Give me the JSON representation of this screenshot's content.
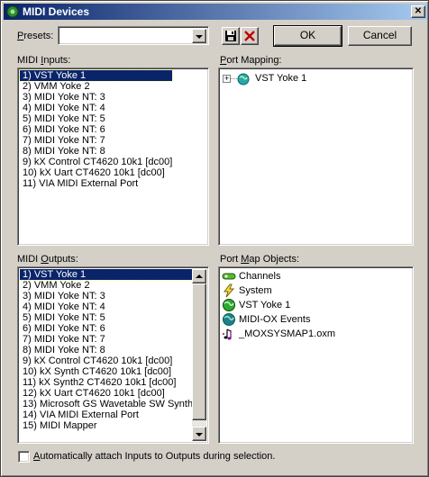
{
  "window": {
    "title": "MIDI Devices"
  },
  "presets": {
    "label_pre": "",
    "label_hot": "P",
    "label_post": "resets:",
    "value": ""
  },
  "buttons": {
    "ok": "OK",
    "cancel": "Cancel"
  },
  "midi_inputs": {
    "label_pre": "MIDI ",
    "label_hot": "I",
    "label_post": "nputs:",
    "items": [
      "1)  VST Yoke 1",
      "2)  VMM Yoke 2",
      "3)  MIDI Yoke NT:  3",
      "4)  MIDI Yoke NT:  4",
      "5)  MIDI Yoke NT:  5",
      "6)  MIDI Yoke NT:  6",
      "7)  MIDI Yoke NT:  7",
      "8)  MIDI Yoke NT:  8",
      "9)  kX Control CT4620 10k1 [dc00]",
      "10)  kX Uart CT4620 10k1 [dc00]",
      "11)  VIA MIDI External Port"
    ],
    "selected_index": 0
  },
  "port_mapping": {
    "label_pre": "",
    "label_hot": "P",
    "label_post": "ort Mapping:",
    "tree_expander": "+",
    "tree_item": "VST Yoke 1"
  },
  "midi_outputs": {
    "label_pre": "MIDI ",
    "label_hot": "O",
    "label_post": "utputs:",
    "items": [
      "1)  VST Yoke 1",
      "2)  VMM Yoke 2",
      "3)  MIDI Yoke NT:  3",
      "4)  MIDI Yoke NT:  4",
      "5)  MIDI Yoke NT:  5",
      "6)  MIDI Yoke NT:  6",
      "7)  MIDI Yoke NT:  7",
      "8)  MIDI Yoke NT:  8",
      "9)  kX Control CT4620 10k1 [dc00]",
      "10)  kX Synth CT4620 10k1 [dc00]",
      "11)  kX Synth2 CT4620 10k1 [dc00]",
      "12)  kX Uart CT4620 10k1 [dc00]",
      "13)  Microsoft GS Wavetable SW Synth",
      "14)  VIA MIDI External Port",
      "15)  MIDI Mapper"
    ],
    "selected_index": 0
  },
  "port_map_objects": {
    "label_pre": "Port ",
    "label_hot": "M",
    "label_post": "ap Objects:",
    "items": [
      {
        "label": "Channels",
        "icon": "channels-icon"
      },
      {
        "label": "System",
        "icon": "system-icon"
      },
      {
        "label": "VST Yoke 1",
        "icon": "globe-green-icon"
      },
      {
        "label": "MIDI-OX Events",
        "icon": "globe-teal-icon"
      },
      {
        "label": "_MOXSYSMAP1.oxm",
        "icon": "music-file-icon"
      }
    ]
  },
  "auto_attach": {
    "label_pre": "",
    "label_hot": "A",
    "label_post": "utomatically attach Inputs to Outputs during selection.",
    "checked": false
  },
  "colors": {
    "face": "#d4d0c8",
    "selection": "#0a246a",
    "title_start": "#0a246a",
    "title_end": "#a6caf0"
  }
}
